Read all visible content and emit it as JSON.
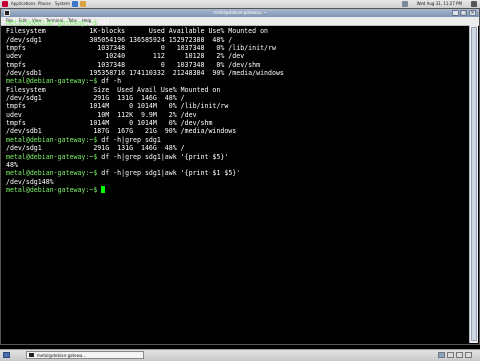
{
  "top_panel": {
    "menus": [
      "Applications",
      "Places",
      "System"
    ],
    "clock": "Wed Aug 31, 11:27 PM"
  },
  "window": {
    "title": "metal@debian-gateway: ~",
    "menus": [
      "File",
      "Edit",
      "View",
      "Terminal",
      "Tabs",
      "Help"
    ]
  },
  "terminal": {
    "lines": [
      {
        "prompt": "metal@debian-gateway:~$ ",
        "text": "df"
      },
      {
        "prompt": "",
        "text": "Filesystem           1K-blocks      Used Available Use% Mounted on"
      },
      {
        "prompt": "",
        "text": "/dev/sdg1            305054196 136585924 152972388  48% /"
      },
      {
        "prompt": "",
        "text": "tmpfs                  1037348         0   1037348   0% /lib/init/rw"
      },
      {
        "prompt": "",
        "text": "udev                     10240       112     10128   2% /dev"
      },
      {
        "prompt": "",
        "text": "tmpfs                  1037348         0   1037348   0% /dev/shm"
      },
      {
        "prompt": "",
        "text": "/dev/sdb1            195358716 174110332  21248384  90% /media/windows"
      },
      {
        "prompt": "metal@debian-gateway:~$ ",
        "text": "df -h"
      },
      {
        "prompt": "",
        "text": "Filesystem            Size  Used Avail Use% Mounted on"
      },
      {
        "prompt": "",
        "text": "/dev/sdg1             291G  131G  146G  48% /"
      },
      {
        "prompt": "",
        "text": "tmpfs                1014M     0 1014M   0% /lib/init/rw"
      },
      {
        "prompt": "",
        "text": "udev                   10M  112K  9.9M   2% /dev"
      },
      {
        "prompt": "",
        "text": "tmpfs                1014M     0 1014M   0% /dev/shm"
      },
      {
        "prompt": "",
        "text": "/dev/sdb1             187G  167G   21G  90% /media/windows"
      },
      {
        "prompt": "metal@debian-gateway:~$ ",
        "text": "df -h|grep sdg1"
      },
      {
        "prompt": "",
        "text": "/dev/sdg1             291G  131G  146G  48% /"
      },
      {
        "prompt": "metal@debian-gateway:~$ ",
        "text": "df -h|grep sdg1|awk '{print $5}'"
      },
      {
        "prompt": "",
        "text": "48%"
      },
      {
        "prompt": "metal@debian-gateway:~$ ",
        "text": "df -h|grep sdg1|awk '{print $1 $5}'"
      },
      {
        "prompt": "",
        "text": "/dev/sdg148%"
      },
      {
        "prompt": "metal@debian-gateway:~$ ",
        "text": "",
        "cursor": true
      }
    ]
  },
  "taskbar": {
    "task_label": "metal@debian-gatewa..."
  },
  "colors": {
    "prompt": "#7cf266",
    "output": "#ffffff",
    "cursor": "#00ff00",
    "background": "#000000"
  }
}
